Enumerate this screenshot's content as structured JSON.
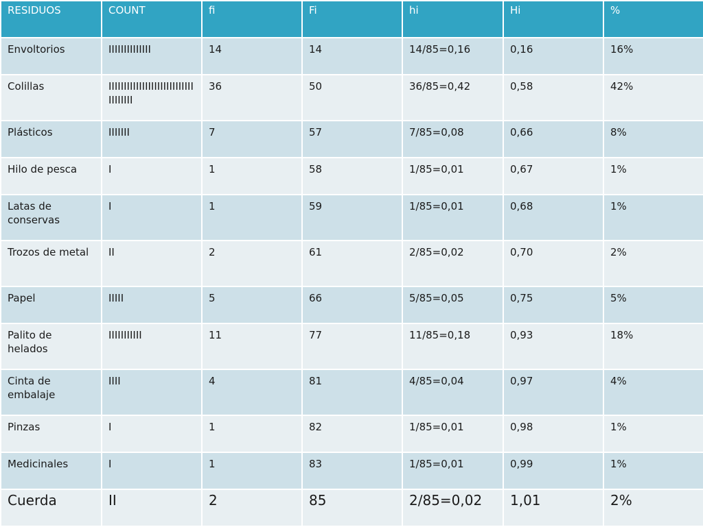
{
  "table": {
    "headers": [
      "RESIDUOS",
      "COUNT",
      "fi",
      "Fi",
      "hi",
      "Hi",
      "%"
    ],
    "rows": [
      [
        "Envoltorios",
        "IIIIIIIIIIIIII",
        "14",
        "14",
        "14/85=0,16",
        "0,16",
        "16%"
      ],
      [
        "Colillas",
        "IIIIIIIIIIIIIIIIIIIIIIIIIIIIIIIIIIII",
        "36",
        "50",
        "36/85=0,42",
        "0,58",
        "42%"
      ],
      [
        "Plásticos",
        "IIIIIII",
        "7",
        "57",
        "7/85=0,08",
        "0,66",
        "8%"
      ],
      [
        "Hilo de pesca",
        "I",
        "1",
        "58",
        "1/85=0,01",
        "0,67",
        "1%"
      ],
      [
        "Latas de conservas",
        "I",
        "1",
        "59",
        "1/85=0,01",
        "0,68",
        "1%"
      ],
      [
        "Trozos de metal",
        "II",
        "2",
        "61",
        "2/85=0,02",
        "0,70",
        "2%"
      ],
      [
        "Papel",
        "IIIII",
        "5",
        "66",
        "5/85=0,05",
        "0,75",
        "5%"
      ],
      [
        "Palito de helados",
        "IIIIIIIIIII",
        "11",
        "77",
        "11/85=0,18",
        "0,93",
        "18%"
      ],
      [
        "Cinta de embalaje",
        "IIII",
        "4",
        "81",
        "4/85=0,04",
        "0,97",
        "4%"
      ],
      [
        "Pinzas",
        "I",
        "1",
        "82",
        "1/85=0,01",
        "0,98",
        "1%"
      ],
      [
        "Medicinales",
        "I",
        "1",
        "83",
        "1/85=0,01",
        "0,99",
        "1%"
      ],
      [
        "Cuerda",
        "II",
        "2",
        "85",
        "2/85=0,02",
        "1,01",
        "2%"
      ]
    ]
  },
  "colors": {
    "header": "#31a4c3",
    "row_odd": "#cde0e8",
    "row_even": "#e8eff2"
  }
}
